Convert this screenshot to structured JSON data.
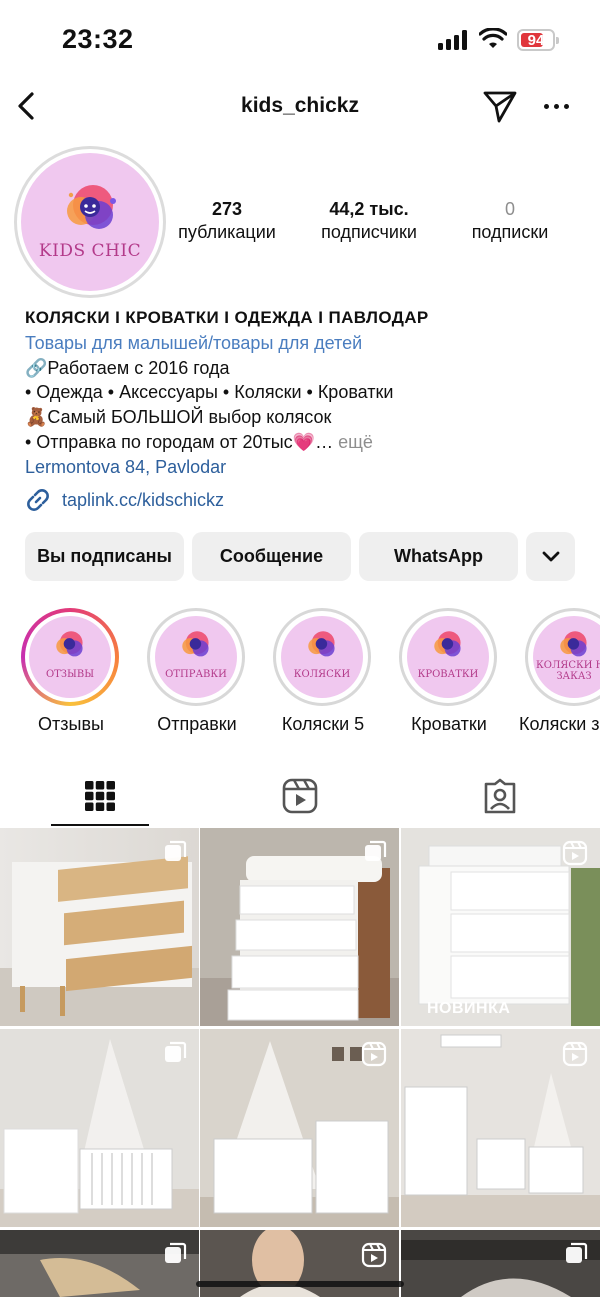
{
  "status_bar": {
    "time": "23:32",
    "battery": "94"
  },
  "header": {
    "username": "kids_chickz"
  },
  "profile": {
    "avatar_text": "KIDS CHIC",
    "stats": [
      {
        "value": "273",
        "label": "публикации"
      },
      {
        "value": "44,2 тыс.",
        "label": "подписчики"
      },
      {
        "value": "0",
        "label": "подписки"
      }
    ],
    "name": "КОЛЯСКИ I КРОВАТКИ I ОДЕЖДА I ПАВЛОДАР",
    "category": "Товары для малышей/товары для детей",
    "bio_lines": [
      "🔗Работаем с 2016 года",
      "• Одежда • Аксессуары • Коляски • Кроватки",
      "🧸Самый БОЛЬШОЙ выбор колясок",
      "• Отправка по городам от 20тыс💗…"
    ],
    "more": "ещё",
    "address": "Lermontova 84, Pavlodar",
    "link": "taplink.cc/kidschickz"
  },
  "buttons": {
    "following": "Вы подписаны",
    "message": "Сообщение",
    "whatsapp": "WhatsApp"
  },
  "highlights": [
    {
      "title": "Отзывы",
      "cover": "ОТЗЫВЫ"
    },
    {
      "title": "Отправки",
      "cover": "ОТПРАВКИ"
    },
    {
      "title": "Коляски 5",
      "cover": "КОЛЯСКИ"
    },
    {
      "title": "Кроватки",
      "cover": "КРОВАТКИ"
    },
    {
      "title": "Коляски з",
      "cover": "КОЛЯСКИ НА ЗАКАЗ"
    }
  ],
  "grid": {
    "new_label": "НОВИНКА"
  }
}
